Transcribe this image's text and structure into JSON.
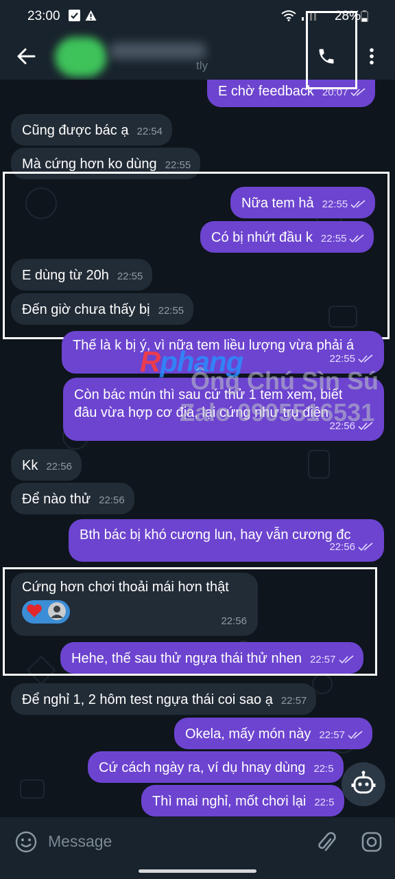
{
  "status_bar": {
    "time": "23:00",
    "battery": "28%"
  },
  "header": {
    "subtitle_fragment": "tly"
  },
  "messages": [
    {
      "id": "m1",
      "dir": "out",
      "text": "E chờ feedback",
      "time": "20:07"
    },
    {
      "id": "m2",
      "dir": "in",
      "text": "Cũng được bác ạ",
      "time": "22:54"
    },
    {
      "id": "m3",
      "dir": "in",
      "text": "Mà cứng hơn ko dùng",
      "time": "22:55"
    },
    {
      "id": "m4",
      "dir": "out",
      "text": "Nữa tem hả",
      "time": "22:55"
    },
    {
      "id": "m5",
      "dir": "out",
      "text": "Có bị nhứt đầu k",
      "time": "22:55"
    },
    {
      "id": "m6",
      "dir": "in",
      "text": "E dùng từ 20h",
      "time": "22:55"
    },
    {
      "id": "m7",
      "dir": "in",
      "text": "Đến giờ chưa thấy bị",
      "time": "22:55"
    },
    {
      "id": "m8",
      "dir": "out",
      "text": "Thế là k bị ý, vì nữa tem liều lượng vừa phải á",
      "time": "22:55"
    },
    {
      "id": "m9",
      "dir": "out",
      "lines": [
        "Còn bác mún thì sau cứ thử 1 tem xem, biết",
        "đâu vừa hợp cơ địa, lại cứng như trụ điện"
      ],
      "time": "22:56"
    },
    {
      "id": "m10",
      "dir": "in",
      "text": "Kk",
      "time": "22:56"
    },
    {
      "id": "m11",
      "dir": "in",
      "text": "Để nào thử",
      "time": "22:56"
    },
    {
      "id": "m12",
      "dir": "out",
      "text": "Bth bác bị khó cương lun, hay vẫn cương đc",
      "time": "22:56"
    },
    {
      "id": "m13",
      "dir": "in",
      "text": "Cứng hơn chơi thoải mái hơn thật",
      "time": "22:56",
      "reactions": [
        "heart",
        "avatar"
      ]
    },
    {
      "id": "m14",
      "dir": "out",
      "text": "Hehe, thế sau thử ngựa thái thử nhen",
      "time": "22:57"
    },
    {
      "id": "m15",
      "dir": "in",
      "text": "Để nghỉ 1, 2 hôm test ngựa thái coi sao ạ",
      "time": "22:57"
    },
    {
      "id": "m16",
      "dir": "out",
      "text": "Okela, mấy món này",
      "time": "22:57"
    },
    {
      "id": "m17",
      "dir": "out",
      "text": "Cứ cách ngày ra, ví dụ hnay dùng",
      "time": "22:5"
    },
    {
      "id": "m18",
      "dir": "out",
      "text": "Thì mai nghỉ, mốt chơi lại",
      "time": "22:5"
    }
  ],
  "watermark": {
    "brand_a": "R",
    "brand_b": "phang",
    "line1": "Ông Chú Sìn Sú",
    "line2": "Zalo 0905516531"
  },
  "composer": {
    "placeholder": "Message"
  },
  "icons": [
    "back-arrow-icon",
    "phone-icon",
    "more-vert-icon",
    "emoji-icon",
    "attach-icon",
    "camera-icon",
    "bot-icon"
  ],
  "colors": {
    "outgoing": "#6c44cf",
    "incoming": "#222c36",
    "bar": "#19232d",
    "background": "#0e151c"
  }
}
